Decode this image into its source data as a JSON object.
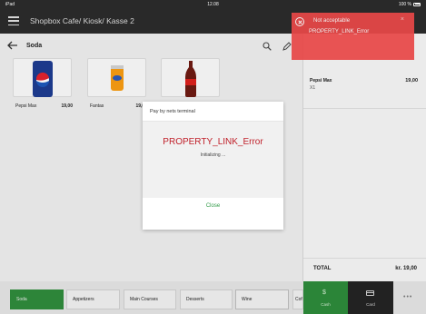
{
  "statusbar": {
    "device": "iPad",
    "time": "12.08",
    "battery": "100 %"
  },
  "header": {
    "title": "Shopbox Cafe/ Kiosk/ Kasse 2"
  },
  "subheader": {
    "category_title": "Soda"
  },
  "products": [
    {
      "name": "Pepsi Max",
      "price": "19,00",
      "image": "pepsi-can"
    },
    {
      "name": "Fantas",
      "price": "19,00",
      "image": "fanta-can"
    },
    {
      "name": "",
      "price": "",
      "image": "cola-bottle"
    }
  ],
  "order": {
    "items": [
      {
        "name": "Pepsi Max",
        "qty": "X1",
        "price": "19,00"
      }
    ],
    "total_label": "TOTAL",
    "total_value": "kr. 19,00"
  },
  "categories": [
    "Soda",
    "Appetizers",
    "Main Courses",
    "Desserts",
    "Wine",
    "Cof"
  ],
  "payment": {
    "cash_label": "Cash",
    "card_label": "Card",
    "more_label": "•••"
  },
  "modal": {
    "title": "Pay by nets terminal",
    "error": "PROPERTY_LINK_Error",
    "status": "Initializing ...",
    "close_label": "Close"
  },
  "toast": {
    "title": "Not acceptable",
    "message": "PROPERTY_LINK_Error",
    "close": "×"
  },
  "colors": {
    "accent_green": "#2f8a3b",
    "error_red": "#c0202a",
    "toast_red": "#e84848",
    "dark": "#2b2b2b"
  }
}
